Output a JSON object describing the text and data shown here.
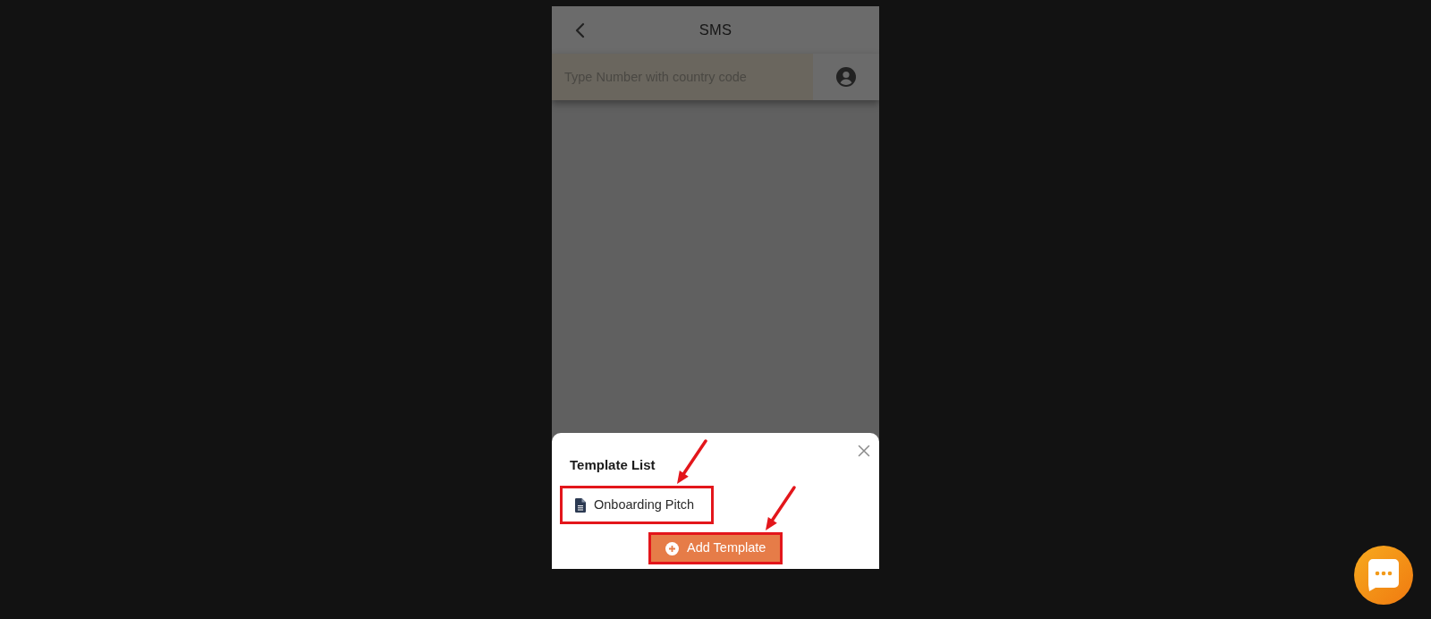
{
  "header": {
    "title": "SMS"
  },
  "recipient": {
    "placeholder": "Type Number with country code"
  },
  "template_sheet": {
    "title": "Template List",
    "templates": [
      {
        "name": "Onboarding Pitch",
        "highlighted": true
      }
    ],
    "add_button": {
      "label": "Add Template",
      "highlighted": true
    }
  }
}
